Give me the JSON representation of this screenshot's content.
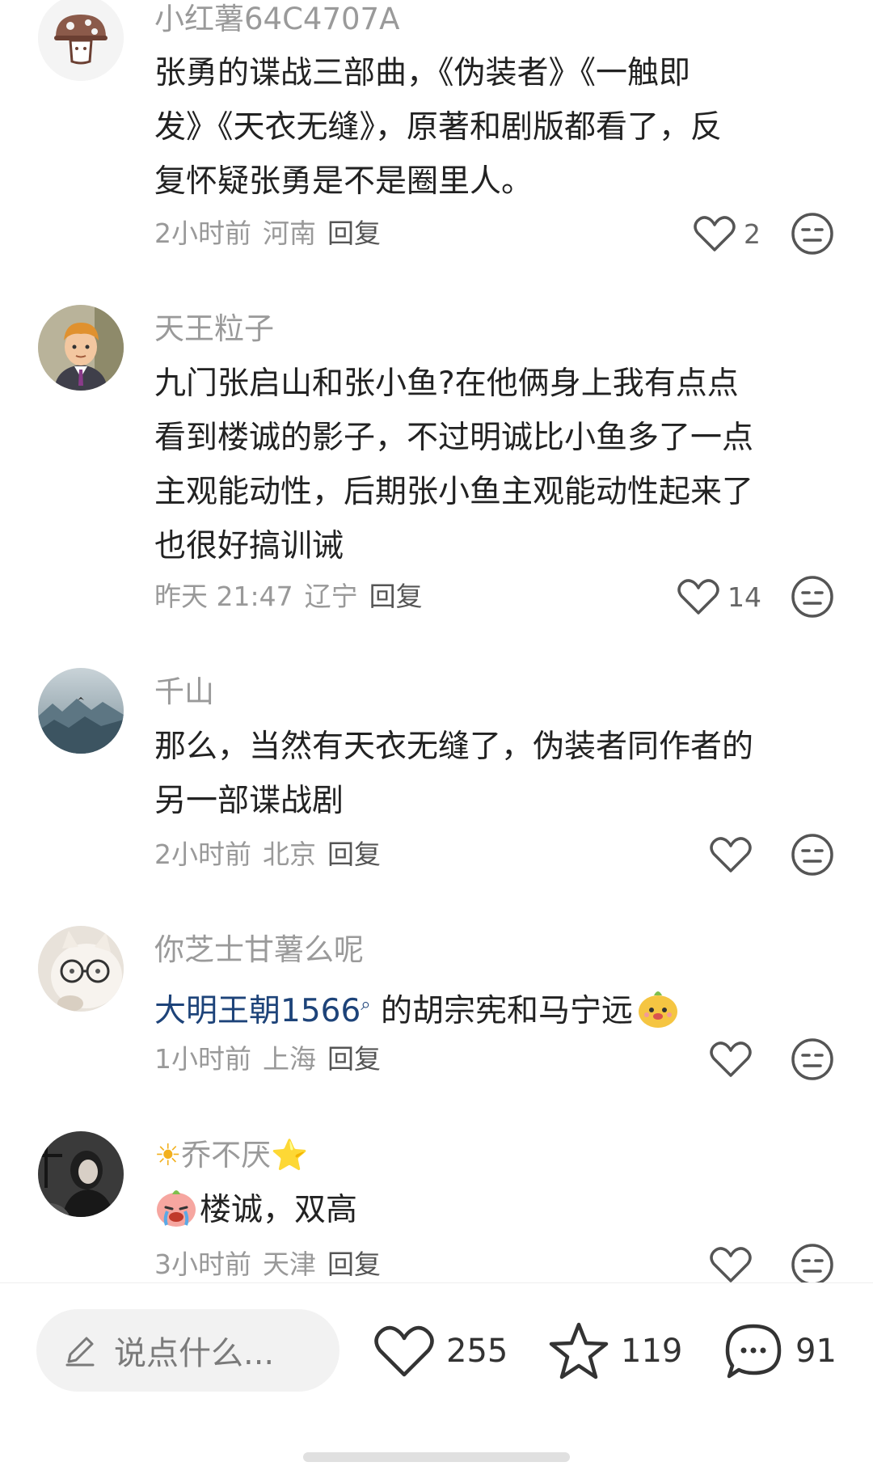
{
  "comments": [
    {
      "username": "小红薯64C4707A",
      "lines": [
        "张勇的谍战三部曲，《伪装者》《一触即",
        "发》《天衣无缝》，原著和剧版都看了，反",
        "复怀疑张勇是不是圈里人。"
      ],
      "time": "2小时前",
      "location": "河南",
      "reply": "回复",
      "likes": "2",
      "avatar_icon": "mushroom-avatar-icon"
    },
    {
      "username": "天王粒子",
      "lines": [
        "九门张启山和张小鱼?在他俩身上我有点点",
        "看到楼诚的影子，不过明诚比小鱼多了一点",
        "主观能动性，后期张小鱼主观能动性起来了",
        "也很好搞训诫"
      ],
      "time": "昨天 21:47",
      "location": "辽宁",
      "reply": "回复",
      "likes": "14",
      "avatar_icon": "cartoon-man-avatar-icon"
    },
    {
      "username": "千山",
      "lines": [
        "那么，当然有天衣无缝了，伪装者同作者的",
        "另一部谍战剧"
      ],
      "time": "2小时前",
      "location": "北京",
      "reply": "回复",
      "likes": "",
      "avatar_icon": "misty-mountain-avatar-icon"
    },
    {
      "username": "你芝士甘薯么呢",
      "link_text": "大明王朝1566",
      "rest_text": " 的胡宗宪和马宁远",
      "time": "1小时前",
      "location": "上海",
      "reply": "回复",
      "likes": "",
      "avatar_icon": "cat-with-glasses-avatar-icon"
    },
    {
      "username_prefix_icon": "☀",
      "username": "乔不厌",
      "username_suffix_icon": "⭐",
      "text": "楼诚，双高",
      "time": "3小时前",
      "location": "天津",
      "reply": "回复",
      "likes": "",
      "avatar_icon": "dark-portrait-avatar-icon"
    }
  ],
  "bottom_bar": {
    "input_placeholder": "说点什么...",
    "likes": "255",
    "favorites": "119",
    "comments": "91"
  },
  "colors": {
    "link": "#1d4379",
    "username": "#9a9a9a",
    "meta": "#999999"
  }
}
